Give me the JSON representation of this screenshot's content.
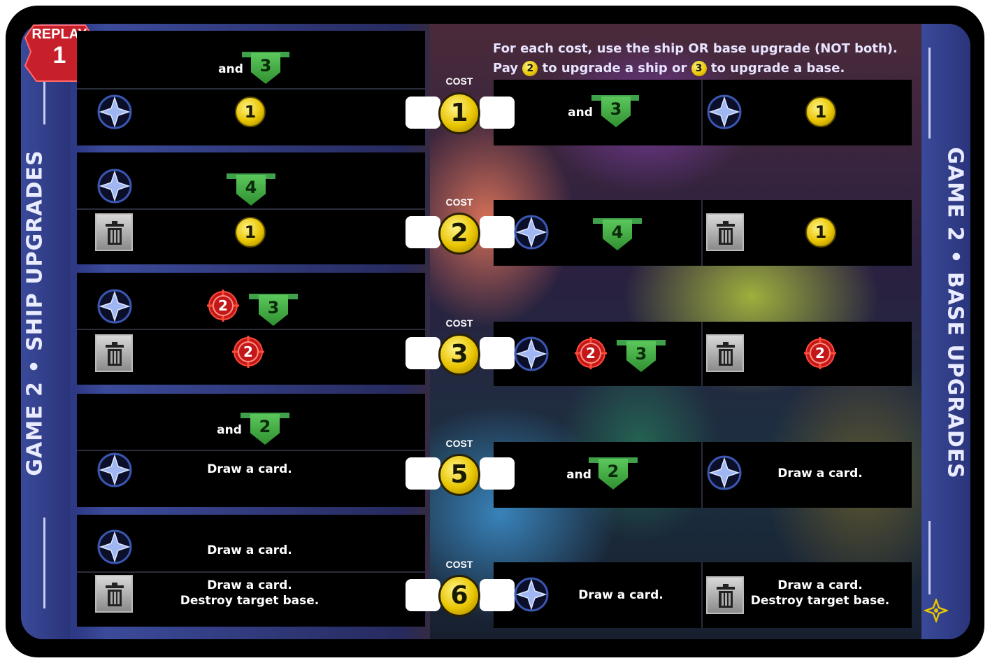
{
  "replay": {
    "label": "REPLAY",
    "number": "1"
  },
  "side_titles": {
    "left": "GAME 2 • SHIP UPGRADES",
    "right": "GAME 2 • BASE UPGRADES"
  },
  "instructions": {
    "line1": "For each cost, use the ship OR base upgrade (NOT both).",
    "line2_a": "Pay",
    "line2_coin_ship": "2",
    "line2_b": "to upgrade a ship or",
    "line2_coin_base": "3",
    "line2_c": "to upgrade a base."
  },
  "cost_label": "COST",
  "tiers": [
    {
      "cost": "1",
      "ship_top_text": "and",
      "ship_top_shield": "3",
      "ship_bottom_coin": "1",
      "base_left_text": "and",
      "base_left_shield": "3",
      "base_right_coin": "1"
    },
    {
      "cost": "2",
      "ship_top_shield": "4",
      "ship_bottom_coin": "1",
      "base_left_shield": "4",
      "base_right_coin": "1"
    },
    {
      "cost": "3",
      "ship_top_target": "2",
      "ship_top_shield": "3",
      "ship_bottom_target": "2",
      "base_left_target": "2",
      "base_left_shield": "3",
      "base_right_target": "2"
    },
    {
      "cost": "5",
      "ship_top_text": "and",
      "ship_top_shield": "2",
      "ship_bottom_text": "Draw a card.",
      "base_left_text": "and",
      "base_left_shield": "2",
      "base_right_text": "Draw a card."
    },
    {
      "cost": "6",
      "ship_top_text": "Draw a card.",
      "ship_bottom_text_1": "Draw a card.",
      "ship_bottom_text_2": "Destroy target base.",
      "base_left_text": "Draw a card.",
      "base_right_text_1": "Draw a card.",
      "base_right_text_2": "Destroy target base."
    }
  ],
  "colors": {
    "trade_coin": "#e8c400",
    "combat_target": "#d11a1a",
    "authority_shield": "#3fa24a",
    "faction_star": "#6f8fd8"
  }
}
